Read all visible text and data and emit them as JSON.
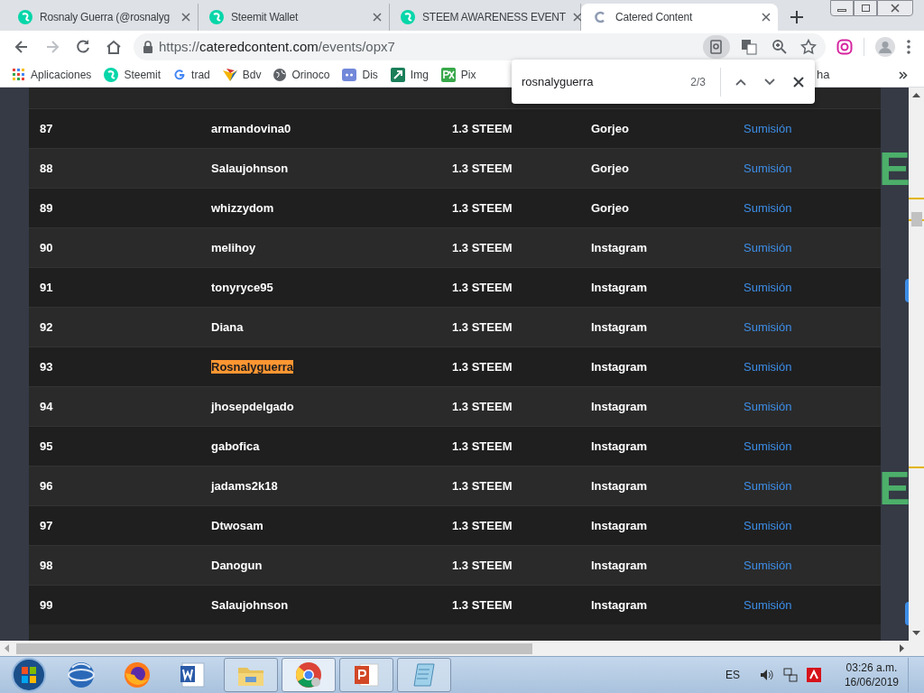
{
  "tabs": [
    {
      "title": "Rosnaly Guerra (@rosnalyg",
      "loading": false,
      "selected": false
    },
    {
      "title": "Steemit Wallet",
      "loading": false,
      "selected": false
    },
    {
      "title": "STEEM AWARENESS EVENT",
      "loading": false,
      "selected": false
    },
    {
      "title": "Catered Content",
      "loading": true,
      "selected": true
    }
  ],
  "address": {
    "scheme": "https://",
    "host": "cateredcontent.com",
    "path": "/events/opx7"
  },
  "bookmarks": [
    {
      "label": "Aplicaciones"
    },
    {
      "label": "Steemit"
    },
    {
      "label": "trad"
    },
    {
      "label": "Bdv"
    },
    {
      "label": "Orinoco"
    },
    {
      "label": "Dis"
    },
    {
      "label": "Img"
    },
    {
      "label": "Pix"
    }
  ],
  "bookmark_cut": "ha",
  "find_bar": {
    "value": "rosnalyguerra",
    "count": "2/3"
  },
  "rows": [
    {
      "number": "87",
      "user": "armandovina0",
      "amount": "1.3 STEEM",
      "platform": "Gorjeo",
      "link": "Sumisión",
      "highlighted": false
    },
    {
      "number": "88",
      "user": "Salaujohnson",
      "amount": "1.3 STEEM",
      "platform": "Gorjeo",
      "link": "Sumisión",
      "highlighted": false
    },
    {
      "number": "89",
      "user": "whizzydom",
      "amount": "1.3 STEEM",
      "platform": "Gorjeo",
      "link": "Sumisión",
      "highlighted": false
    },
    {
      "number": "90",
      "user": "melihoy",
      "amount": "1.3 STEEM",
      "platform": "Instagram",
      "link": "Sumisión",
      "highlighted": false
    },
    {
      "number": "91",
      "user": "tonyryce95",
      "amount": "1.3 STEEM",
      "platform": "Instagram",
      "link": "Sumisión",
      "highlighted": false
    },
    {
      "number": "92",
      "user": "Diana",
      "amount": "1.3 STEEM",
      "platform": "Instagram",
      "link": "Sumisión",
      "highlighted": false
    },
    {
      "number": "93",
      "user": "Rosnalyguerra",
      "amount": "1.3 STEEM",
      "platform": "Instagram",
      "link": "Sumisión",
      "highlighted": true
    },
    {
      "number": "94",
      "user": "jhosepdelgado",
      "amount": "1.3 STEEM",
      "platform": "Instagram",
      "link": "Sumisión",
      "highlighted": false
    },
    {
      "number": "95",
      "user": "gabofica",
      "amount": "1.3 STEEM",
      "platform": "Instagram",
      "link": "Sumisión",
      "highlighted": false
    },
    {
      "number": "96",
      "user": "jadams2k18",
      "amount": "1.3 STEEM",
      "platform": "Instagram",
      "link": "Sumisión",
      "highlighted": false
    },
    {
      "number": "97",
      "user": "Dtwosam",
      "amount": "1.3 STEEM",
      "platform": "Instagram",
      "link": "Sumisión",
      "highlighted": false
    },
    {
      "number": "98",
      "user": "Danogun",
      "amount": "1.3 STEEM",
      "platform": "Instagram",
      "link": "Sumisión",
      "highlighted": false
    },
    {
      "number": "99",
      "user": "Salaujohnson",
      "amount": "1.3 STEEM",
      "platform": "Instagram",
      "link": "Sumisión",
      "highlighted": false
    }
  ],
  "side_letters": [
    "E",
    "E"
  ],
  "taskbar": {
    "language": "ES",
    "time": "03:26 a.m.",
    "date": "16/06/2019"
  }
}
